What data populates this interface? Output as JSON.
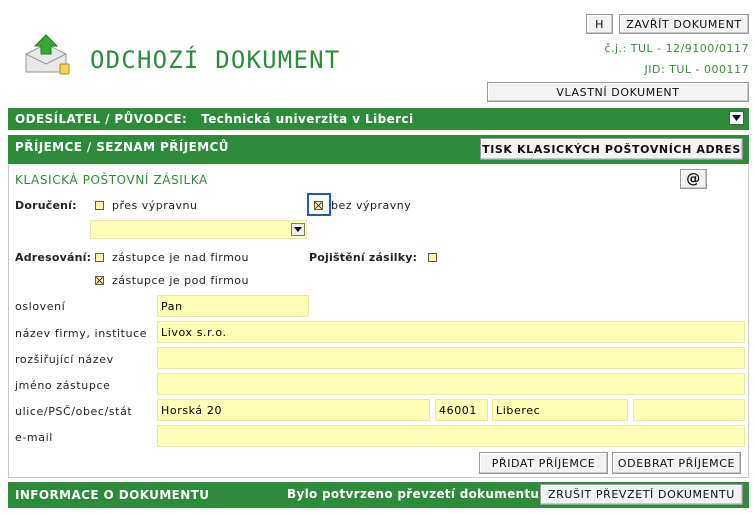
{
  "header": {
    "title": "ODCHOZÍ DOKUMENT",
    "h_button": "H",
    "close_button": "ZAVŘÍT DOKUMENT",
    "cj": "č.j.: TUL - 12/9100/0117",
    "jid": "JID: TUL - 000117",
    "own_doc_button": "VLASTNÍ DOKUMENT"
  },
  "sender_bar": {
    "label": "ODESÍLATEL / PŮVODCE:",
    "value": "Technická univerzita v Liberci"
  },
  "recipients_bar": {
    "label": "PŘÍJEMCE / SEZNAM PŘÍJEMCŮ",
    "print_button": "TISK KLASICKÝCH POŠTOVNÍCH ADRES"
  },
  "panel": {
    "title": "KLASICKÁ POŠTOVNÍ ZÁSILKA",
    "at_button": "@",
    "delivery_label": "Doručení:",
    "delivery_via": "přes výpravnu",
    "delivery_without": "bez výpravny",
    "addressing_label": "Adresování:",
    "addr_above": "zástupce je nad firmou",
    "addr_below": "zástupce je pod firmou",
    "insurance_label": "Pojištění zásilky:",
    "fields": {
      "salutation_label": "oslovení",
      "salutation_value": "Pan",
      "company_label": "název firmy, instituce",
      "company_value": "Livox s.r.o.",
      "ext_name_label": "rozšiřující název",
      "ext_name_value": "",
      "rep_name_label": "jméno zástupce",
      "rep_name_value": "",
      "address_label": "ulice/PSČ/obec/stát",
      "street_value": "Horská 20",
      "zip_value": "46001",
      "city_value": "Liberec",
      "country_value": "",
      "email_label": "e-mail",
      "email_value": ""
    },
    "add_button": "PŘIDAT PŘÍJEMCE",
    "remove_button": "ODEBRAT PŘÍJEMCE"
  },
  "doc_info_bar": {
    "label": "INFORMACE O DOKUMENTU",
    "confirmed_text": "Bylo potvrzeno převzetí dokumentu",
    "cancel_button": "ZRUŠIT PŘEVZETÍ DOKUMENTU"
  },
  "colors": {
    "green": "#2e8b3a",
    "field_yellow": "#ffffb8",
    "meta_green": "#3c8a3c"
  }
}
